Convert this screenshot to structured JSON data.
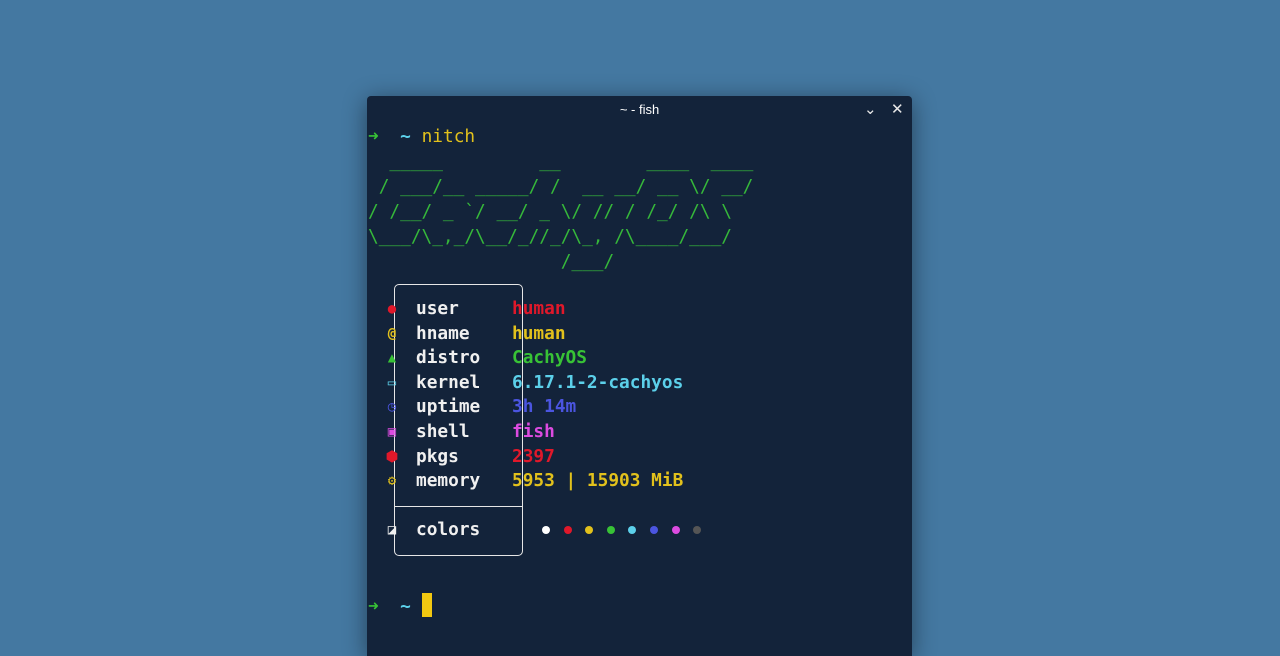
{
  "window": {
    "title": "~ - fish",
    "minimize_icon": "chevron-down",
    "close_icon": "x"
  },
  "prompt": {
    "arrow": "➜",
    "cwd": "~",
    "command": "nitch"
  },
  "ascii_art": [
    "  _____         __        ____  ____",
    " / ___/__ _____/ /  __ __/ __ \\/ __/",
    "/ /__/ _ `/ __/ _ \\/ // / /_/ /\\ \\",
    "\\___/\\_,_/\\__/_//_/\\_, /\\____/___/",
    "                  /___/"
  ],
  "info": [
    {
      "label": "user",
      "value": "human",
      "icon": "user",
      "color": "#e0182a"
    },
    {
      "label": "hname",
      "value": "human",
      "icon": "at",
      "color": "#e2c11c"
    },
    {
      "label": "distro",
      "value": "CachyOS",
      "icon": "linux",
      "color": "#38c236"
    },
    {
      "label": "kernel",
      "value": "6.17.1-2-cachyos",
      "icon": "laptop",
      "color": "#5cd0ea"
    },
    {
      "label": "uptime",
      "value": "3h 14m",
      "icon": "clock",
      "color": "#4b55e0"
    },
    {
      "label": "shell",
      "value": "fish",
      "icon": "terminal",
      "color": "#dc4be0"
    },
    {
      "label": "pkgs",
      "value": "2397",
      "icon": "package",
      "color": "#e0182a"
    },
    {
      "label": "memory",
      "value": "5953 | 15903 MiB",
      "icon": "chip",
      "color": "#e2c11c"
    }
  ],
  "colors_row": {
    "label": "colors",
    "icon": "palette",
    "swatches": [
      "#ffffff",
      "#e0182a",
      "#e2c11c",
      "#38c236",
      "#5cd0ea",
      "#4b55e0",
      "#dc4be0",
      "#555555"
    ]
  },
  "prompt2": {
    "arrow": "➜",
    "cwd": "~"
  }
}
